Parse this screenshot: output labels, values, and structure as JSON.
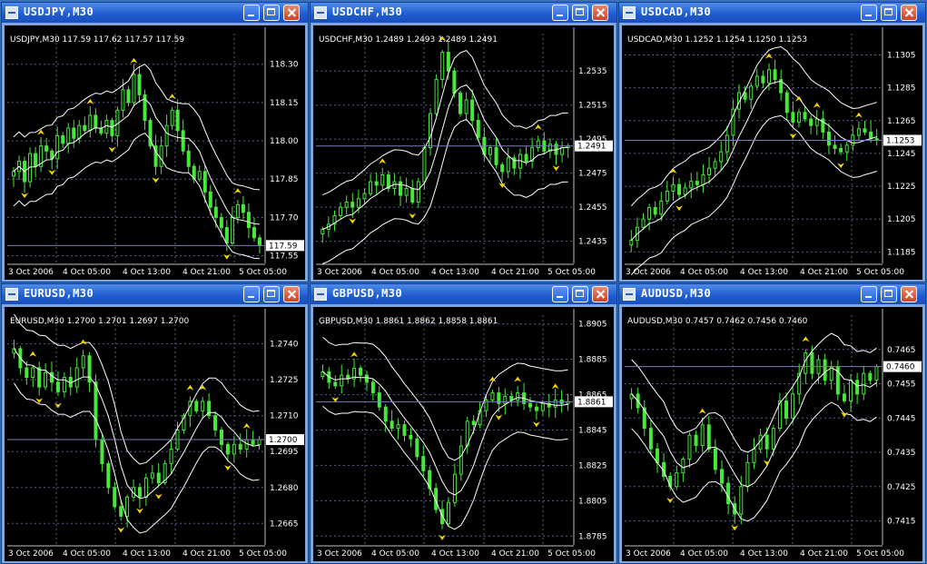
{
  "windows": [
    {
      "symbol": "USDJPY",
      "tf": "M30",
      "title": "USDJPY,M30",
      "header": "USDJPY,M30  117.59 117.62 117.57 117.59",
      "ymin": 117.52,
      "ymax": 118.42,
      "yticks": [
        118.3,
        118.15,
        118.0,
        117.85,
        117.7,
        117.55
      ],
      "last": 117.59,
      "dec": 2,
      "xlabels": [
        "3 Oct 2006",
        "4 Oct 05:00",
        "4 Oct 13:00",
        "4 Oct 21:00",
        "5 Oct 05:00"
      ],
      "close": [
        117.88,
        117.92,
        117.84,
        117.95,
        117.9,
        117.98,
        117.96,
        117.93,
        118.02,
        117.99,
        118.05,
        118.01,
        118.06,
        118.04,
        118.1,
        118.05,
        118.03,
        118.08,
        118.02,
        118.12,
        118.2,
        118.15,
        118.26,
        118.18,
        118.08,
        117.98,
        117.9,
        117.98,
        118.06,
        118.12,
        118.04,
        117.96,
        117.9,
        117.85,
        117.88,
        117.8,
        117.74,
        117.7,
        117.66,
        117.6,
        117.7,
        117.75,
        117.72,
        117.66,
        117.62,
        117.59
      ],
      "up": [],
      "down": []
    },
    {
      "symbol": "USDCHF",
      "tf": "M30",
      "title": "USDCHF,M30",
      "header": "USDCHF,M30  1.2489 1.2493 1.2489 1.2491",
      "ymin": 1.2422,
      "ymax": 1.2557,
      "yticks": [
        1.2535,
        1.2515,
        1.2495,
        1.2475,
        1.2455,
        1.2435
      ],
      "last": 1.2491,
      "dec": 4,
      "xlabels": [
        "3 Oct 2006",
        "4 Oct 05:00",
        "4 Oct 13:00",
        "4 Oct 21:00",
        "5 Oct 05:00"
      ],
      "close": [
        1.2442,
        1.2445,
        1.245,
        1.2455,
        1.2458,
        1.2455,
        1.246,
        1.2463,
        1.247,
        1.2468,
        1.2474,
        1.2466,
        1.247,
        1.2462,
        1.2466,
        1.2458,
        1.247,
        1.249,
        1.251,
        1.253,
        1.2546,
        1.2535,
        1.2522,
        1.251,
        1.2518,
        1.2506,
        1.2496,
        1.2486,
        1.249,
        1.248,
        1.2476,
        1.2484,
        1.2478,
        1.2486,
        1.2482,
        1.249,
        1.2494,
        1.2488,
        1.2492,
        1.2486,
        1.249,
        1.2491
      ],
      "up": [],
      "down": []
    },
    {
      "symbol": "USDCAD",
      "tf": "M30",
      "title": "USDCAD,M30",
      "header": "USDCAD,M30  1.1252 1.1254 1.1250 1.1253",
      "ymin": 1.1178,
      "ymax": 1.1318,
      "yticks": [
        1.1305,
        1.1285,
        1.1265,
        1.1245,
        1.1225,
        1.1205,
        1.1185
      ],
      "last": 1.1253,
      "dec": 4,
      "xlabels": [
        "3 Oct 2006",
        "4 Oct 05:00",
        "4 Oct 13:00",
        "4 Oct 21:00",
        "5 Oct 05:00"
      ],
      "close": [
        1.1192,
        1.12,
        1.1205,
        1.1212,
        1.1208,
        1.1216,
        1.1222,
        1.1226,
        1.122,
        1.1224,
        1.1228,
        1.1226,
        1.1232,
        1.1236,
        1.124,
        1.1246,
        1.1256,
        1.1272,
        1.1282,
        1.1278,
        1.1286,
        1.1292,
        1.1288,
        1.1296,
        1.129,
        1.1282,
        1.127,
        1.1264,
        1.127,
        1.1266,
        1.1262,
        1.1266,
        1.1258,
        1.125,
        1.1248,
        1.1246,
        1.125,
        1.1256,
        1.126,
        1.1258,
        1.1254,
        1.1253
      ],
      "up": [],
      "down": []
    },
    {
      "symbol": "EURUSD",
      "tf": "M30",
      "title": "EURUSD,M30",
      "header": "EURUSD,M30  1.2700 1.2701 1.2697 1.2700",
      "ymin": 1.2656,
      "ymax": 1.2752,
      "yticks": [
        1.274,
        1.2725,
        1.271,
        1.2695,
        1.268,
        1.2665
      ],
      "last": 1.27,
      "dec": 4,
      "xlabels": [
        "3 Oct 2006",
        "4 Oct 05:00",
        "4 Oct 13:00",
        "4 Oct 21:00",
        "5 Oct 05:00"
      ],
      "close": [
        1.2738,
        1.273,
        1.2726,
        1.273,
        1.2722,
        1.2728,
        1.2724,
        1.272,
        1.2726,
        1.2722,
        1.273,
        1.2735,
        1.2724,
        1.27,
        1.269,
        1.268,
        1.2672,
        1.2668,
        1.2676,
        1.268,
        1.2676,
        1.2684,
        1.2686,
        1.2682,
        1.269,
        1.2696,
        1.2704,
        1.271,
        1.2716,
        1.2712,
        1.2716,
        1.271,
        1.2704,
        1.2698,
        1.2694,
        1.2698,
        1.2696,
        1.27,
        1.2698,
        1.27
      ],
      "up": [],
      "down": []
    },
    {
      "symbol": "GBPUSD",
      "tf": "M30",
      "title": "GBPUSD,M30",
      "header": "GBPUSD,M30  1.8861 1.8862 1.8858 1.8861",
      "ymin": 1.878,
      "ymax": 1.891,
      "yticks": [
        1.8905,
        1.8885,
        1.8865,
        1.8845,
        1.8825,
        1.8805,
        1.8785
      ],
      "last": 1.8861,
      "dec": 4,
      "xlabels": [
        "3 Oct 2006",
        "4 Oct 05:00",
        "4 Oct 13:00",
        "4 Oct 21:00",
        "5 Oct 05:00"
      ],
      "close": [
        1.8878,
        1.8872,
        1.887,
        1.8876,
        1.8874,
        1.888,
        1.8876,
        1.8872,
        1.8866,
        1.8858,
        1.885,
        1.8846,
        1.8848,
        1.8842,
        1.884,
        1.883,
        1.8822,
        1.8812,
        1.88,
        1.8792,
        1.8804,
        1.882,
        1.8836,
        1.885,
        1.8848,
        1.8856,
        1.8862,
        1.8866,
        1.886,
        1.8864,
        1.8862,
        1.8866,
        1.886,
        1.8858,
        1.8856,
        1.886,
        1.8858,
        1.8862,
        1.886,
        1.8861
      ],
      "up": [],
      "down": []
    },
    {
      "symbol": "AUDUSD",
      "tf": "M30",
      "title": "AUDUSD,M30",
      "header": "AUDUSD,M30  0.7457 0.7462 0.7456 0.7460",
      "ymin": 0.7408,
      "ymax": 0.7475,
      "yticks": [
        0.7465,
        0.7455,
        0.7445,
        0.7435,
        0.7425,
        0.7415
      ],
      "last": 0.746,
      "dec": 4,
      "xlabels": [
        "3 Oct 2006",
        "4 Oct 05:00",
        "4 Oct 13:00",
        "4 Oct 21:00",
        "5 Oct 05:00"
      ],
      "close": [
        0.7452,
        0.7448,
        0.7442,
        0.7436,
        0.7432,
        0.7428,
        0.7425,
        0.7429,
        0.7433,
        0.744,
        0.7437,
        0.7443,
        0.7436,
        0.743,
        0.7426,
        0.742,
        0.7417,
        0.7425,
        0.7432,
        0.7436,
        0.744,
        0.7436,
        0.7442,
        0.745,
        0.7445,
        0.7452,
        0.7458,
        0.7464,
        0.7458,
        0.7462,
        0.7456,
        0.746,
        0.7452,
        0.745,
        0.7456,
        0.7452,
        0.7458,
        0.7456,
        0.746
      ],
      "up": [],
      "down": []
    }
  ],
  "colors": {
    "background": "#000000",
    "grid": "#5a5f8a",
    "candle": "#46e83a",
    "band": "#ffffff",
    "arrow": "#f2d600",
    "price_line": "#7c80b8",
    "axis_text": "#ffffff",
    "titlebar": "#1d5bd0"
  },
  "chart_data": [
    {
      "type": "candlestick",
      "title": "USDJPY,M30",
      "ylim": [
        117.52,
        118.42
      ],
      "x": [
        "3 Oct 2006",
        "4 Oct 05:00",
        "4 Oct 13:00",
        "4 Oct 21:00",
        "5 Oct 05:00"
      ],
      "last": 117.59
    },
    {
      "type": "candlestick",
      "title": "USDCHF,M30",
      "ylim": [
        1.2422,
        1.2557
      ],
      "x": [
        "3 Oct 2006",
        "4 Oct 05:00",
        "4 Oct 13:00",
        "4 Oct 21:00",
        "5 Oct 05:00"
      ],
      "last": 1.2491
    },
    {
      "type": "candlestick",
      "title": "USDCAD,M30",
      "ylim": [
        1.1178,
        1.1318
      ],
      "x": [
        "3 Oct 2006",
        "4 Oct 05:00",
        "4 Oct 13:00",
        "4 Oct 21:00",
        "5 Oct 05:00"
      ],
      "last": 1.1253
    },
    {
      "type": "candlestick",
      "title": "EURUSD,M30",
      "ylim": [
        1.2656,
        1.2752
      ],
      "x": [
        "3 Oct 2006",
        "4 Oct 05:00",
        "4 Oct 13:00",
        "4 Oct 21:00",
        "5 Oct 05:00"
      ],
      "last": 1.27
    },
    {
      "type": "candlestick",
      "title": "GBPUSD,M30",
      "ylim": [
        1.878,
        1.891
      ],
      "x": [
        "3 Oct 2006",
        "4 Oct 05:00",
        "4 Oct 13:00",
        "4 Oct 21:00",
        "5 Oct 05:00"
      ],
      "last": 1.8861
    },
    {
      "type": "candlestick",
      "title": "AUDUSD,M30",
      "ylim": [
        0.7408,
        0.7475
      ],
      "x": [
        "3 Oct 2006",
        "4 Oct 05:00",
        "4 Oct 13:00",
        "4 Oct 21:00",
        "5 Oct 05:00"
      ],
      "last": 0.746
    }
  ]
}
